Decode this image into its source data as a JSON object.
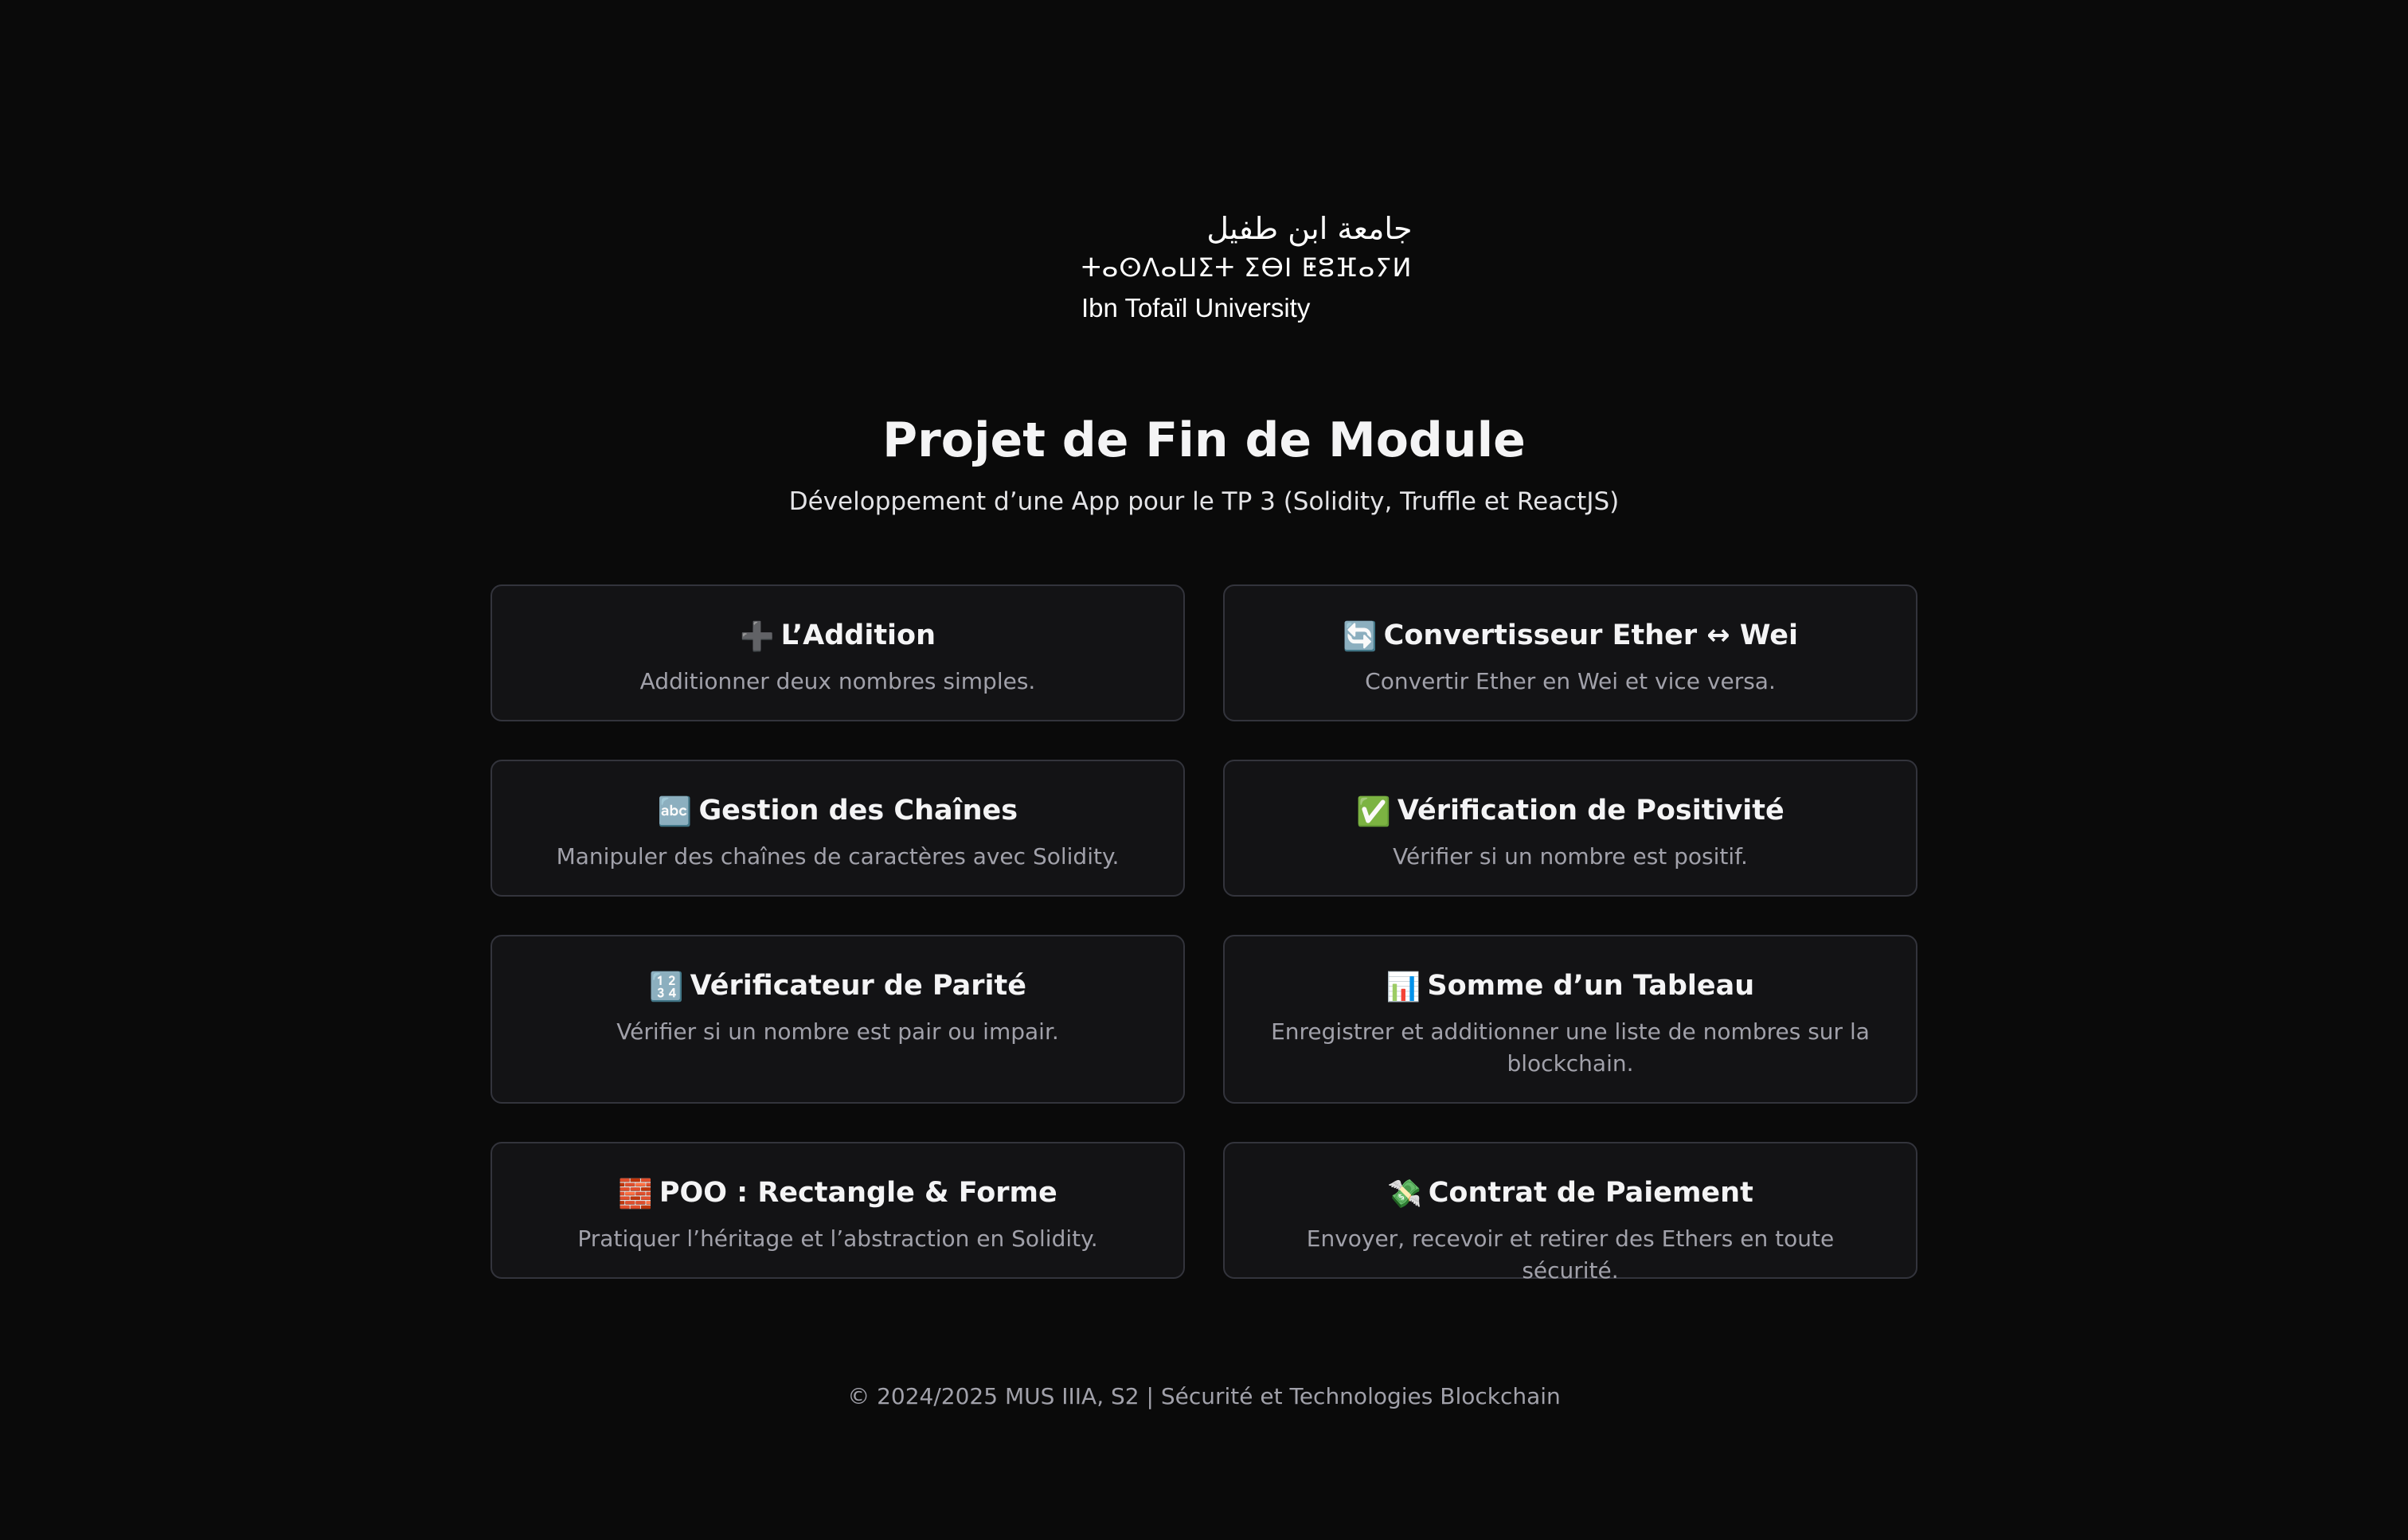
{
  "logo": {
    "arabic": "جامعة ابن طفيل",
    "tifinagh": "ⵜⴰⵙⴷⴰⵡⵉⵜ ⵉⴱⵏ ⵟⵓⴼⴰⵢⵍ",
    "english": "Ibn Tofaïl University"
  },
  "header": {
    "title": "Projet de Fin de Module",
    "subtitle": "Développement d’une App pour le TP 3 (Solidity, Truffle et ReactJS)"
  },
  "cards": [
    {
      "icon": "➕",
      "title": "L’Addition",
      "description": "Additionner deux nombres simples."
    },
    {
      "icon": "🔄",
      "title": "Convertisseur Ether ↔ Wei",
      "description": "Convertir Ether en Wei et vice versa."
    },
    {
      "icon": "🔤",
      "title": "Gestion des Chaînes",
      "description": "Manipuler des chaînes de caractères avec Solidity."
    },
    {
      "icon": "✅",
      "title": "Vérification de Positivité",
      "description": "Vérifier si un nombre est positif."
    },
    {
      "icon": "🔢",
      "title": "Vérificateur de Parité",
      "description": "Vérifier si un nombre est pair ou impair."
    },
    {
      "icon": "📊",
      "title": "Somme d’un Tableau",
      "description": "Enregistrer et additionner une liste de nombres sur la blockchain."
    },
    {
      "icon": "🧱",
      "title": "POO : Rectangle & Forme",
      "description": "Pratiquer l’héritage et l’abstraction en Solidity."
    },
    {
      "icon": "💸",
      "title": "Contrat de Paiement",
      "description": "Envoyer, recevoir et retirer des Ethers en toute sécurité."
    }
  ],
  "footer": {
    "text": "© 2024/2025 MUS IIIA, S2 | Sécurité et Technologies Blockchain"
  }
}
